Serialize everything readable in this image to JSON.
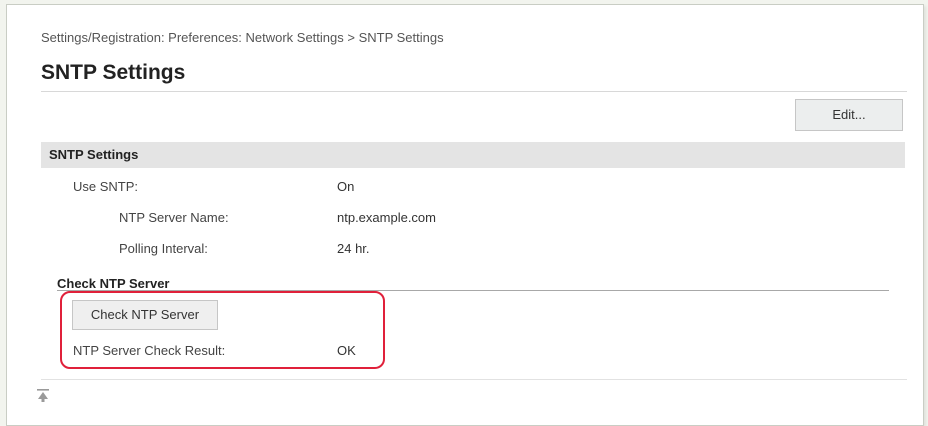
{
  "breadcrumb": "Settings/Registration: Preferences: Network Settings > SNTP Settings",
  "page_title": "SNTP Settings",
  "edit_button": "Edit...",
  "section": {
    "title": "SNTP Settings",
    "use_sntp": {
      "label": "Use SNTP:",
      "value": "On"
    },
    "ntp_server_name": {
      "label": "NTP Server Name:",
      "value": "ntp.example.com"
    },
    "polling_interval": {
      "label": "Polling Interval:",
      "value": "24 hr."
    }
  },
  "check": {
    "heading": "Check NTP Server",
    "button": "Check NTP Server",
    "result_label": "NTP Server Check Result:",
    "result_value": "OK"
  },
  "icons": {
    "back_to_top": "back-to-top-icon"
  },
  "colors": {
    "highlight": "#e0203a",
    "section_bar": "#e4e4e4"
  }
}
